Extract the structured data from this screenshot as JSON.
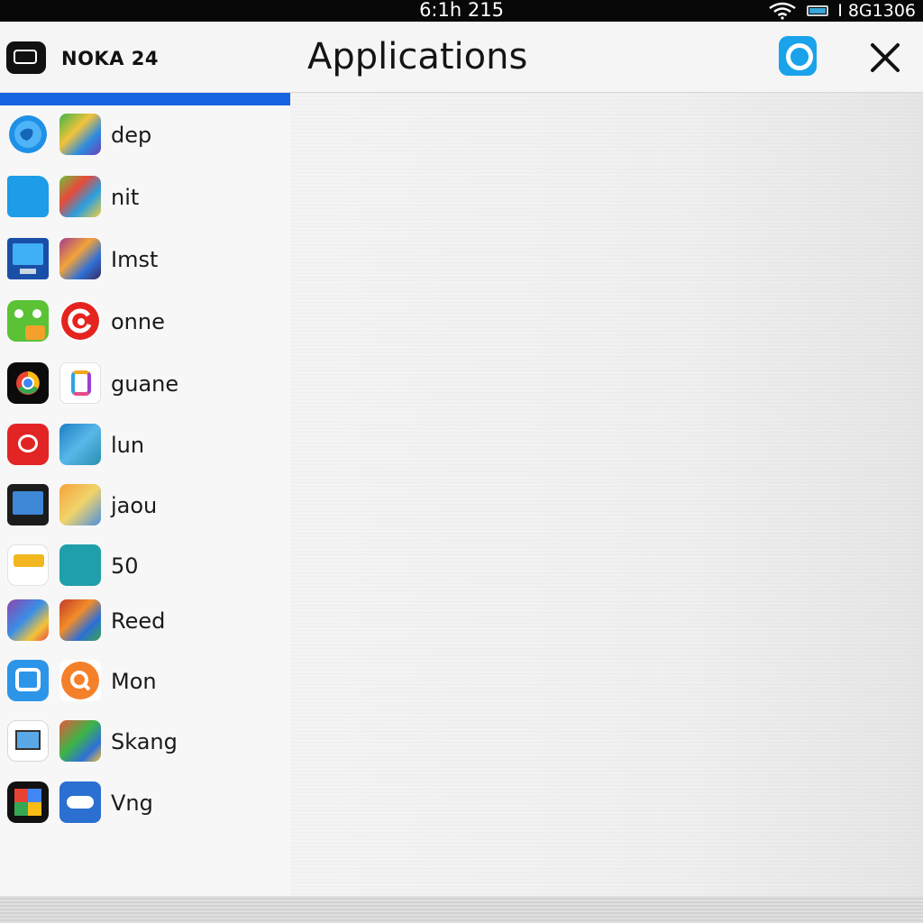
{
  "status_bar": {
    "time": "6:1h 215",
    "right_text": "I 8G1306"
  },
  "header": {
    "device_name": "NOKA 24",
    "title": "Applications",
    "search_icon": "search-icon",
    "close_icon": "close-icon"
  },
  "apps": [
    {
      "label": "dep"
    },
    {
      "label": "nit"
    },
    {
      "label": "Imst"
    },
    {
      "label": "onne"
    },
    {
      "label": "guane"
    },
    {
      "label": "lun"
    },
    {
      "label": "jaou"
    },
    {
      "label": "50"
    },
    {
      "label": "Reed"
    },
    {
      "label": "Mon"
    },
    {
      "label": "Skang"
    },
    {
      "label": "Vng"
    }
  ],
  "colors": {
    "accent": "#1565e0",
    "search_button": "#19a3ea"
  }
}
